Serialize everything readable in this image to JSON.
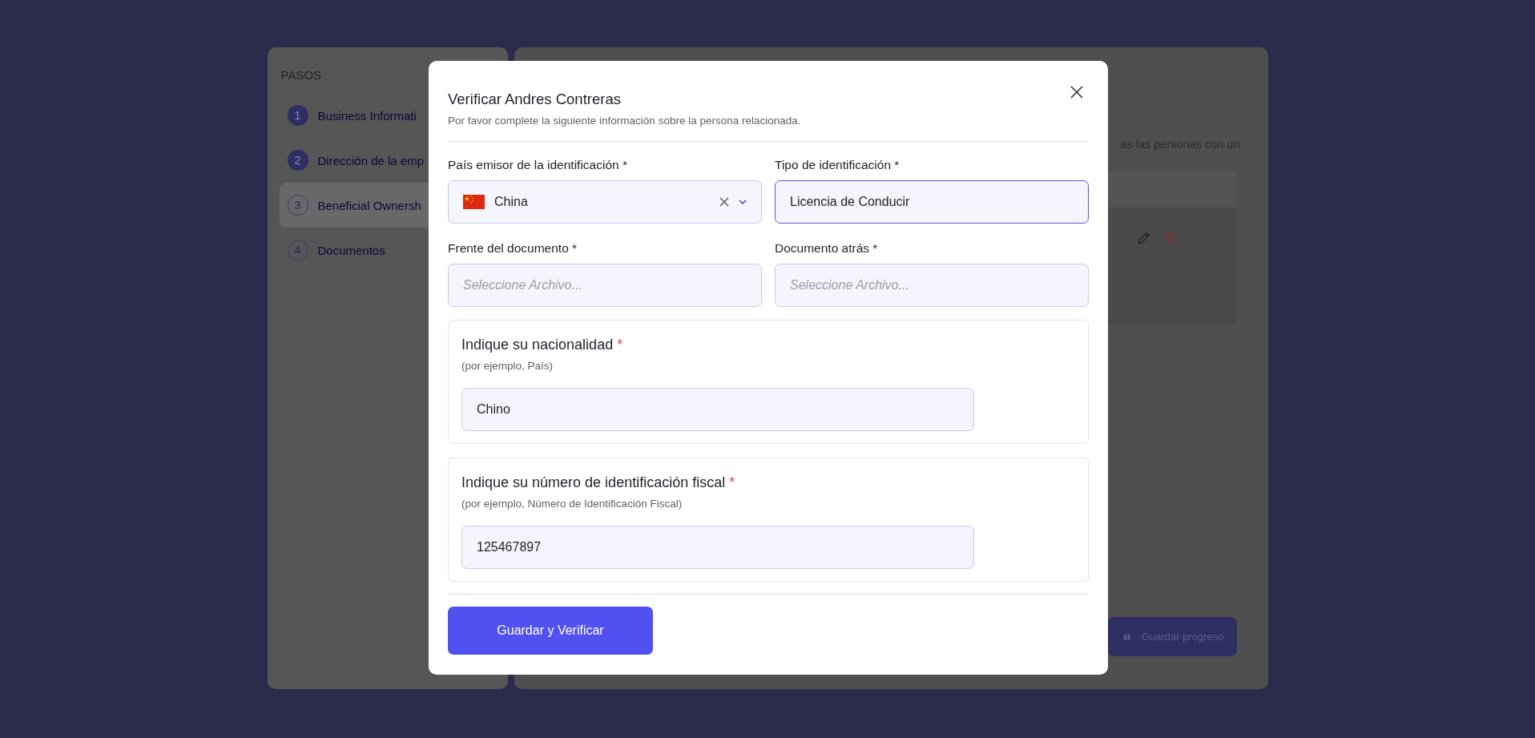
{
  "sidebar": {
    "heading": "PASOS",
    "steps": [
      {
        "number": "1",
        "label": "Business Informati",
        "completed": true,
        "selected": false
      },
      {
        "number": "2",
        "label": "Dirección de la emp",
        "completed": true,
        "selected": false
      },
      {
        "number": "3",
        "label": "Beneficial Ownersh",
        "completed": false,
        "selected": true
      },
      {
        "number": "4",
        "label": "Documentos",
        "completed": false,
        "selected": false
      }
    ]
  },
  "main": {
    "intro": "as las personas con un",
    "save_button": "Guardar progreso"
  },
  "modal": {
    "title": "Verificar Andres Contreras",
    "subtitle": "Por favor complete la siguiente información sobre la persona relacionada.",
    "fields": [
      {
        "kind": "country",
        "label": "País emisor de la identificación *",
        "value": "China",
        "focused": false
      },
      {
        "kind": "text",
        "label": "Tipo de identificación *",
        "value": "Licencia de Conducir",
        "focused": true
      },
      {
        "kind": "file",
        "label": "Frente del documento *",
        "placeholder": "Seleccione Archivo...",
        "focused": false
      },
      {
        "kind": "file",
        "label": "Documento atrás *",
        "placeholder": "Seleccione Archivo...",
        "focused": false
      }
    ],
    "questions": [
      {
        "title": "Indique su nacionalidad",
        "required_mark": "*",
        "hint": "(por ejemplo, País)",
        "value": "Chino"
      },
      {
        "title": "Indique su número de identificación fiscal",
        "required_mark": "*",
        "hint": "(por ejemplo, Número de Identificación Fiscal)",
        "value": "125467897"
      }
    ],
    "submit": "Guardar y Verificar"
  }
}
